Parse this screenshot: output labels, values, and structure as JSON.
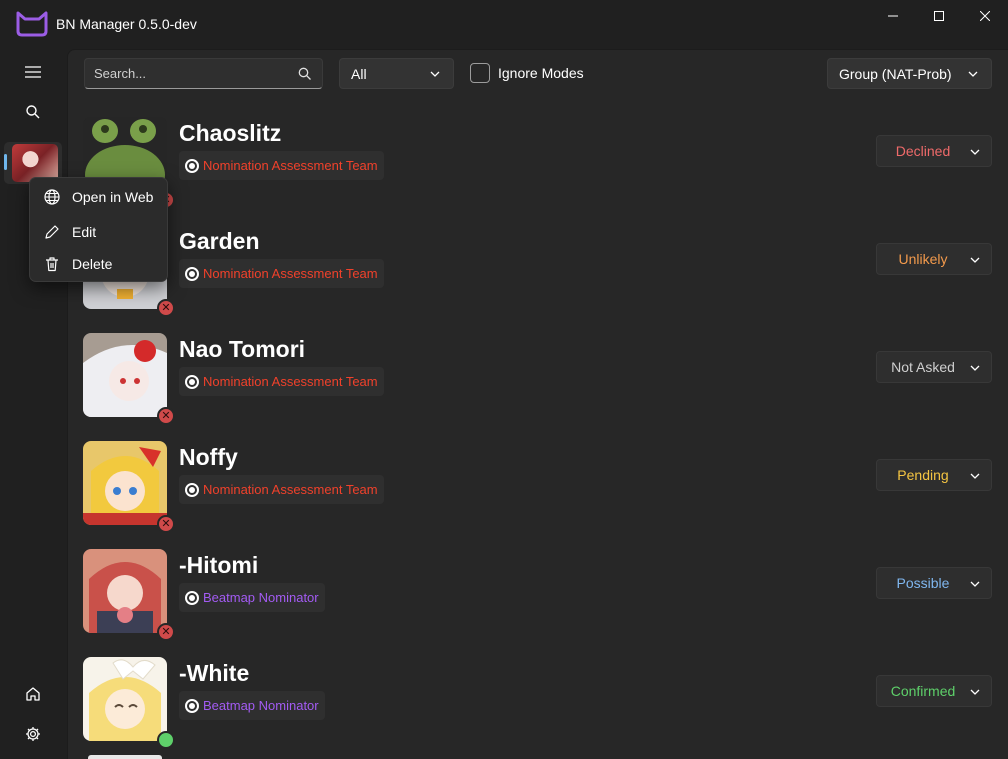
{
  "window": {
    "title": "BN Manager 0.5.0-dev"
  },
  "toolbar": {
    "search_placeholder": "Search...",
    "filter_value": "All",
    "ignore_modes_label": "Ignore Modes",
    "ignore_modes_checked": false,
    "group_value": "Group (NAT-Prob)"
  },
  "context_menu": {
    "open_label": "Open in Web",
    "edit_label": "Edit",
    "delete_label": "Delete"
  },
  "users": [
    {
      "name": "Chaoslitz",
      "group": "Nomination Assessment Team",
      "group_color": "#f0412b",
      "status": "Declined",
      "status_color": "#ef6a6a",
      "online": false
    },
    {
      "name": "Garden",
      "group": "Nomination Assessment Team",
      "group_color": "#f0412b",
      "status": "Unlikely",
      "status_color": "#f39a4c",
      "online": false
    },
    {
      "name": "Nao Tomori",
      "group": "Nomination Assessment Team",
      "group_color": "#f0412b",
      "status": "Not Asked",
      "status_color": "#cfcfcf",
      "online": false
    },
    {
      "name": "Noffy",
      "group": "Nomination Assessment Team",
      "group_color": "#f0412b",
      "status": "Pending",
      "status_color": "#f5c542",
      "online": false
    },
    {
      "name": "-Hitomi",
      "group": "Beatmap Nominator",
      "group_color": "#a35bf3",
      "status": "Possible",
      "status_color": "#7fb6ee",
      "online": false
    },
    {
      "name": "-White",
      "group": "Beatmap Nominator",
      "group_color": "#a35bf3",
      "status": "Confirmed",
      "status_color": "#5ed06a",
      "online": true
    }
  ],
  "icons": {
    "logo": "cat-head-icon",
    "menu": "hamburger-menu-icon",
    "search": "search-icon",
    "home": "home-icon",
    "settings": "gear-icon",
    "web": "globe-icon",
    "edit": "pencil-icon",
    "delete": "trash-icon"
  }
}
